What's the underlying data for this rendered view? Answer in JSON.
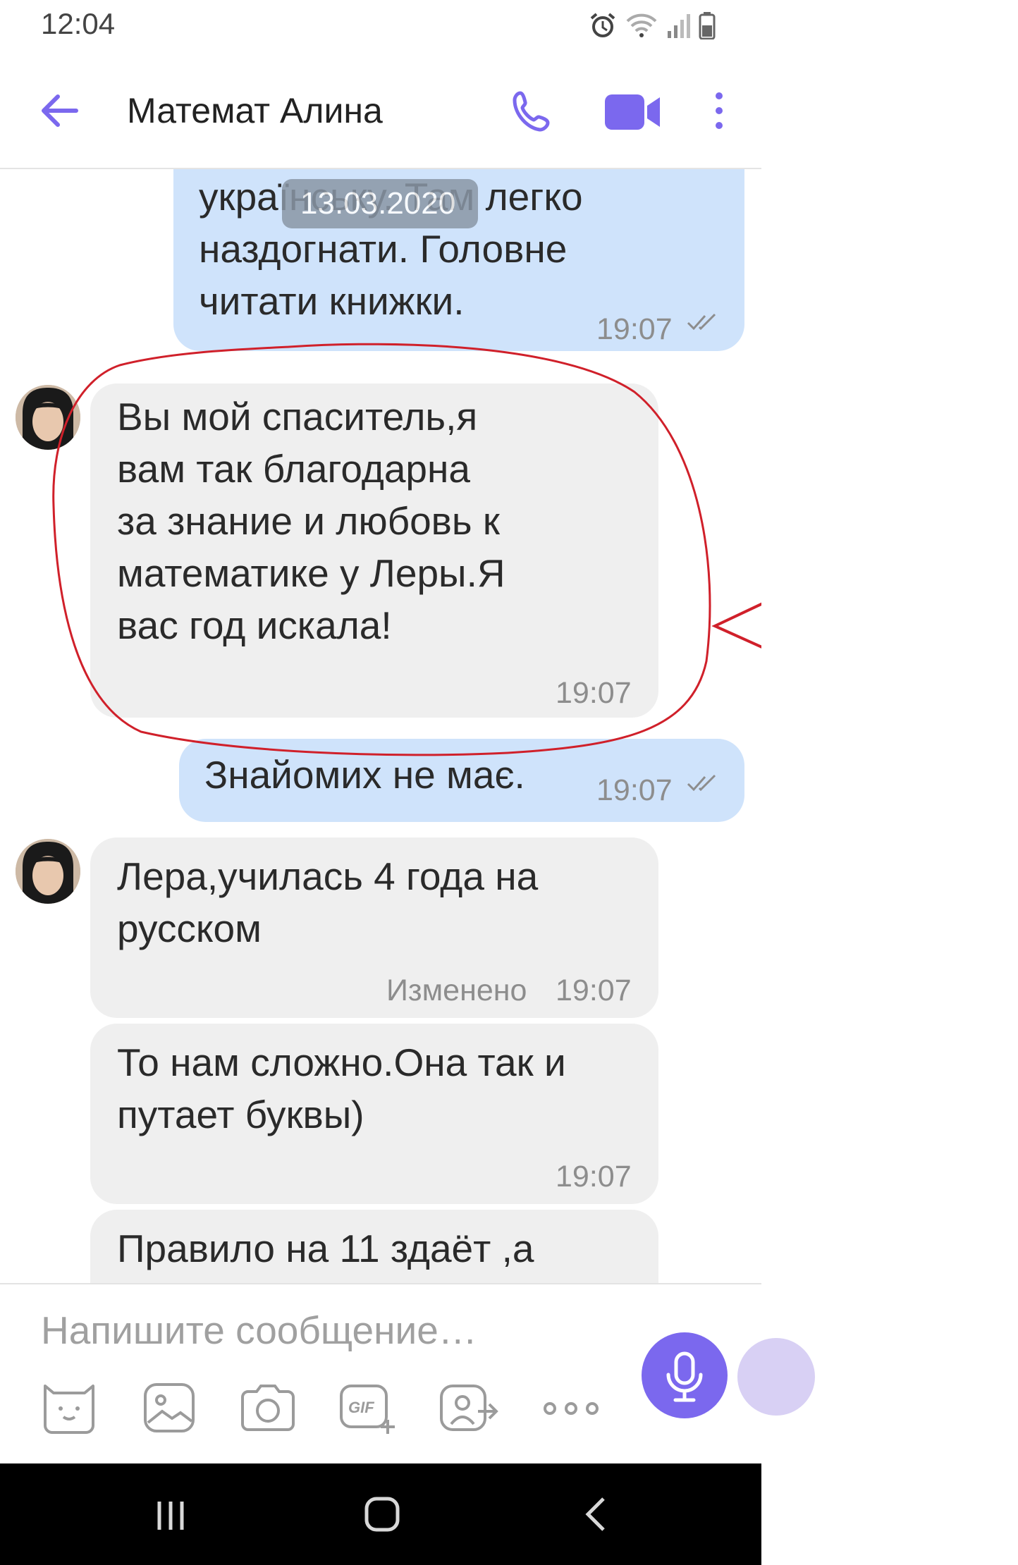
{
  "status_bar": {
    "time": "12:04"
  },
  "header": {
    "title": "Математ Алина",
    "icons": [
      "back-arrow-icon",
      "phone-icon",
      "video-camera-icon",
      "more-vert-icon"
    ],
    "accent_color": "#7b68ee"
  },
  "chat": {
    "date_chip": "13.03.2020",
    "messages": [
      {
        "direction": "outgoing",
        "lines": [
          "українську. Там легко",
          "наздогнати. Головне",
          "читати книжки."
        ],
        "time": "19:07",
        "status": "read"
      },
      {
        "direction": "incoming",
        "lines": [
          "Вы мой спаситель,я",
          "вам так благодарна",
          "за знание и любовь к",
          "математике у Леры.Я",
          "вас год искала!"
        ],
        "time": "19:07"
      },
      {
        "direction": "outgoing",
        "lines": [
          "Знайомих не має."
        ],
        "time": "19:07",
        "status": "read"
      },
      {
        "direction": "incoming",
        "lines": [
          "Лера,училась 4 года на",
          "русском"
        ],
        "edited": "Изменено",
        "time": "19:07"
      },
      {
        "direction": "incoming",
        "lines": [
          "То нам сложно.Она так и",
          "путает буквы)"
        ],
        "time": "19:07"
      },
      {
        "direction": "incoming",
        "lines": [
          "Правило на 11 здаёт ,а"
        ]
      }
    ]
  },
  "composer": {
    "placeholder": "Напишите сообщение…",
    "tools": [
      "sticker-icon",
      "gallery-icon",
      "camera-icon",
      "gif-icon",
      "share-contact-icon",
      "more-horiz-icon"
    ],
    "mic_icon": "microphone-icon"
  },
  "nav_bar": {
    "icons": [
      "recent-apps-icon",
      "home-icon",
      "back-icon"
    ]
  },
  "annotation": {
    "color": "#d0202a"
  }
}
